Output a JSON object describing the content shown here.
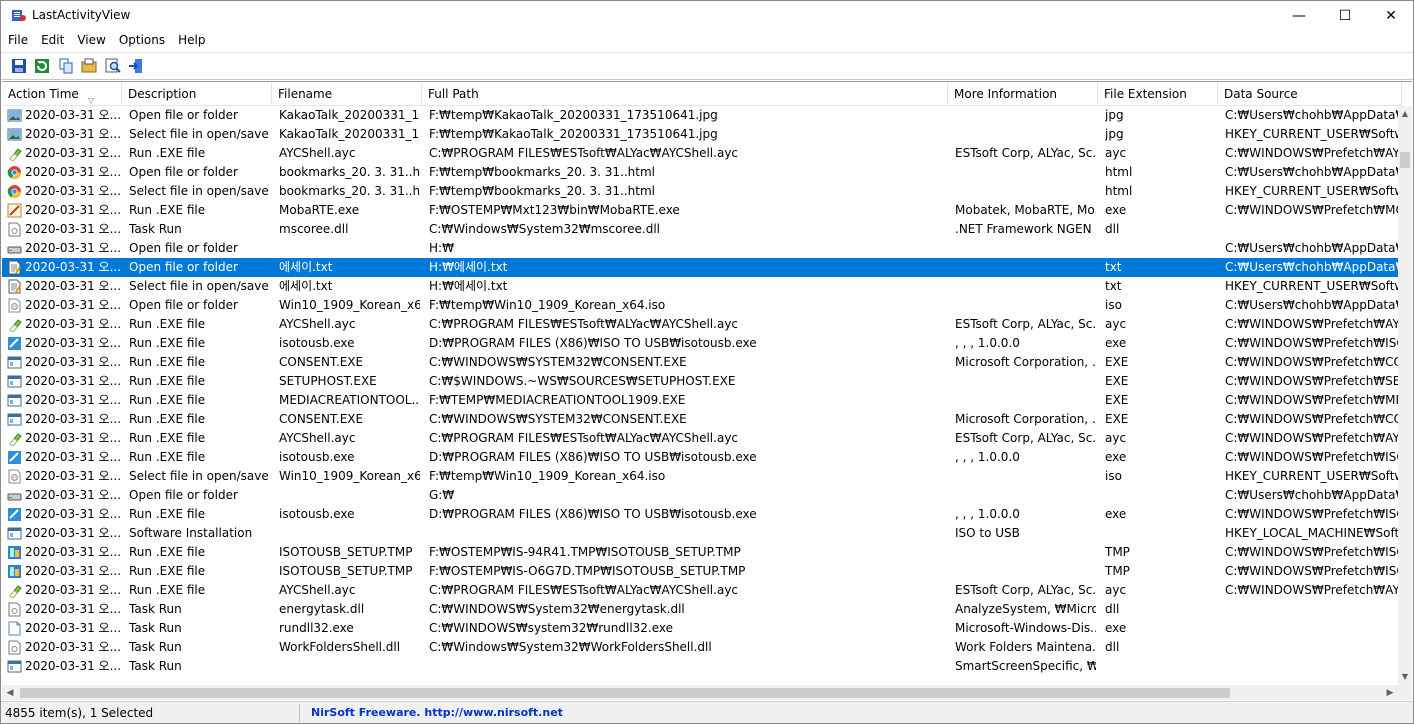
{
  "window": {
    "title": "LastActivityView",
    "minimize_glyph": "—",
    "maximize_glyph": "☐",
    "close_glyph": "✕"
  },
  "menu": [
    "File",
    "Edit",
    "View",
    "Options",
    "Help"
  ],
  "toolbar": {
    "buttons": [
      "save-icon",
      "refresh-icon",
      "copy-icon",
      "properties-icon",
      "find-icon",
      "exit-icon"
    ]
  },
  "columns": [
    "Action Time",
    "Description",
    "Filename",
    "Full Path",
    "More Information",
    "File Extension",
    "Data Source"
  ],
  "sort_indicator": "▽",
  "rows": [
    {
      "icon": "image-file-icon",
      "time": "2020-03-31 오...",
      "desc": "Open file or folder",
      "file": "KakaoTalk_20200331_1...",
      "path": "F:₩temp₩KakaoTalk_20200331_173510641.jpg",
      "info": "",
      "ext": "jpg",
      "src": "C:₩Users₩chohb₩AppData₩Roa"
    },
    {
      "icon": "image-file-icon",
      "time": "2020-03-31 오...",
      "desc": "Select file in open/save ...",
      "file": "KakaoTalk_20200331_1...",
      "path": "F:₩temp₩KakaoTalk_20200331_173510641.jpg",
      "info": "",
      "ext": "jpg",
      "src": "HKEY_CURRENT_USER₩Software"
    },
    {
      "icon": "alyac-pill-icon",
      "time": "2020-03-31 오...",
      "desc": "Run .EXE file",
      "file": "AYCShell.ayc",
      "path": "C:₩PROGRAM FILES₩ESTsoft₩ALYac₩AYCShell.ayc",
      "info": "ESTsoft Corp, ALYac, Sc...",
      "ext": "ayc",
      "src": "C:₩WINDOWS₩Prefetch₩AYCS"
    },
    {
      "icon": "chrome-icon",
      "time": "2020-03-31 오...",
      "desc": "Open file or folder",
      "file": "bookmarks_20. 3. 31..h...",
      "path": "F:₩temp₩bookmarks_20. 3. 31..html",
      "info": "",
      "ext": "html",
      "src": "C:₩Users₩chohb₩AppData₩Roa"
    },
    {
      "icon": "chrome-icon",
      "time": "2020-03-31 오...",
      "desc": "Select file in open/save ...",
      "file": "bookmarks_20. 3. 31..h...",
      "path": "F:₩temp₩bookmarks_20. 3. 31..html",
      "info": "",
      "ext": "html",
      "src": "HKEY_CURRENT_USER₩Software"
    },
    {
      "icon": "mobarte-icon",
      "time": "2020-03-31 오...",
      "desc": "Run .EXE file",
      "file": "MobaRTE.exe",
      "path": "F:₩OSTEMP₩Mxt123₩bin₩MobaRTE.exe",
      "info": "Mobatek, MobaRTE, Mo...",
      "ext": "exe",
      "src": "C:₩WINDOWS₩Prefetch₩MOBA"
    },
    {
      "icon": "dll-file-icon",
      "time": "2020-03-31 오...",
      "desc": "Task Run",
      "file": "mscoree.dll",
      "path": "C:₩Windows₩System32₩mscoree.dll",
      "info": ".NET Framework NGEN ...",
      "ext": "dll",
      "src": ""
    },
    {
      "icon": "drive-icon",
      "time": "2020-03-31 오...",
      "desc": "Open file or folder",
      "file": "",
      "path": "H:₩",
      "info": "",
      "ext": "",
      "src": "C:₩Users₩chohb₩AppData₩Roa"
    },
    {
      "icon": "text-file-icon",
      "time": "2020-03-31 오...",
      "desc": "Open file or folder",
      "file": "에세이.txt",
      "path": "H:₩에세이.txt",
      "info": "",
      "ext": "txt",
      "src": "C:₩Users₩chohb₩AppData₩Roa",
      "selected": true
    },
    {
      "icon": "text-file-icon",
      "time": "2020-03-31 오...",
      "desc": "Select file in open/save ...",
      "file": "에세이.txt",
      "path": "H:₩에세이.txt",
      "info": "",
      "ext": "txt",
      "src": "HKEY_CURRENT_USER₩Software"
    },
    {
      "icon": "iso-file-icon",
      "time": "2020-03-31 오...",
      "desc": "Open file or folder",
      "file": "Win10_1909_Korean_x6...",
      "path": "F:₩temp₩Win10_1909_Korean_x64.iso",
      "info": "",
      "ext": "iso",
      "src": "C:₩Users₩chohb₩AppData₩Roa"
    },
    {
      "icon": "alyac-pill-icon",
      "time": "2020-03-31 오...",
      "desc": "Run .EXE file",
      "file": "AYCShell.ayc",
      "path": "C:₩PROGRAM FILES₩ESTsoft₩ALYac₩AYCShell.ayc",
      "info": "ESTsoft Corp, ALYac, Sc...",
      "ext": "ayc",
      "src": "C:₩WINDOWS₩Prefetch₩AYCS"
    },
    {
      "icon": "isotousb-icon",
      "time": "2020-03-31 오...",
      "desc": "Run .EXE file",
      "file": "isotousb.exe",
      "path": "D:₩PROGRAM FILES (X86)₩ISO TO USB₩isotousb.exe",
      "info": ", , , 1.0.0.0",
      "ext": "exe",
      "src": "C:₩WINDOWS₩Prefetch₩ISOTC"
    },
    {
      "icon": "exe-window-icon",
      "time": "2020-03-31 오...",
      "desc": "Run .EXE file",
      "file": "CONSENT.EXE",
      "path": "C:₩WINDOWS₩SYSTEM32₩CONSENT.EXE",
      "info": "Microsoft Corporation, ...",
      "ext": "EXE",
      "src": "C:₩WINDOWS₩Prefetch₩CONS"
    },
    {
      "icon": "exe-window-icon",
      "time": "2020-03-31 오...",
      "desc": "Run .EXE file",
      "file": "SETUPHOST.EXE",
      "path": "C:₩$WINDOWS.~WS₩SOURCES₩SETUPHOST.EXE",
      "info": "",
      "ext": "EXE",
      "src": "C:₩WINDOWS₩Prefetch₩SETUP"
    },
    {
      "icon": "exe-window-icon",
      "time": "2020-03-31 오...",
      "desc": "Run .EXE file",
      "file": "MEDIACREATIONTOOL...",
      "path": "F:₩TEMP₩MEDIACREATIONTOOL1909.EXE",
      "info": "",
      "ext": "EXE",
      "src": "C:₩WINDOWS₩Prefetch₩MEDI"
    },
    {
      "icon": "exe-window-icon",
      "time": "2020-03-31 오...",
      "desc": "Run .EXE file",
      "file": "CONSENT.EXE",
      "path": "C:₩WINDOWS₩SYSTEM32₩CONSENT.EXE",
      "info": "Microsoft Corporation, ...",
      "ext": "EXE",
      "src": "C:₩WINDOWS₩Prefetch₩CONS"
    },
    {
      "icon": "alyac-pill-icon",
      "time": "2020-03-31 오...",
      "desc": "Run .EXE file",
      "file": "AYCShell.ayc",
      "path": "C:₩PROGRAM FILES₩ESTsoft₩ALYac₩AYCShell.ayc",
      "info": "ESTsoft Corp, ALYac, Sc...",
      "ext": "ayc",
      "src": "C:₩WINDOWS₩Prefetch₩AYCS"
    },
    {
      "icon": "isotousb-icon",
      "time": "2020-03-31 오...",
      "desc": "Run .EXE file",
      "file": "isotousb.exe",
      "path": "D:₩PROGRAM FILES (X86)₩ISO TO USB₩isotousb.exe",
      "info": ", , , 1.0.0.0",
      "ext": "exe",
      "src": "C:₩WINDOWS₩Prefetch₩ISOTC"
    },
    {
      "icon": "iso-file-icon",
      "time": "2020-03-31 오...",
      "desc": "Select file in open/save ...",
      "file": "Win10_1909_Korean_x6...",
      "path": "F:₩temp₩Win10_1909_Korean_x64.iso",
      "info": "",
      "ext": "iso",
      "src": "HKEY_CURRENT_USER₩Software"
    },
    {
      "icon": "drive-icon",
      "time": "2020-03-31 오...",
      "desc": "Open file or folder",
      "file": "",
      "path": "G:₩",
      "info": "",
      "ext": "",
      "src": "C:₩Users₩chohb₩AppData₩Roa"
    },
    {
      "icon": "isotousb-icon",
      "time": "2020-03-31 오...",
      "desc": "Run .EXE file",
      "file": "isotousb.exe",
      "path": "D:₩PROGRAM FILES (X86)₩ISO TO USB₩isotousb.exe",
      "info": ", , , 1.0.0.0",
      "ext": "exe",
      "src": "C:₩WINDOWS₩Prefetch₩ISOTC"
    },
    {
      "icon": "exe-window-icon",
      "time": "2020-03-31 오...",
      "desc": "Software Installation",
      "file": "",
      "path": "",
      "info": "ISO to USB",
      "ext": "",
      "src": "HKEY_LOCAL_MACHINE₩Softw"
    },
    {
      "icon": "setup-tmp-icon",
      "time": "2020-03-31 오...",
      "desc": "Run .EXE file",
      "file": "ISOTOUSB_SETUP.TMP",
      "path": "F:₩OSTEMP₩IS-94R41.TMP₩ISOTOUSB_SETUP.TMP",
      "info": "",
      "ext": "TMP",
      "src": "C:₩WINDOWS₩Prefetch₩ISOTC"
    },
    {
      "icon": "setup-tmp-icon",
      "time": "2020-03-31 오...",
      "desc": "Run .EXE file",
      "file": "ISOTOUSB_SETUP.TMP",
      "path": "F:₩OSTEMP₩IS-O6G7D.TMP₩ISOTOUSB_SETUP.TMP",
      "info": "",
      "ext": "TMP",
      "src": "C:₩WINDOWS₩Prefetch₩ISOTC"
    },
    {
      "icon": "alyac-pill-icon",
      "time": "2020-03-31 오...",
      "desc": "Run .EXE file",
      "file": "AYCShell.ayc",
      "path": "C:₩PROGRAM FILES₩ESTsoft₩ALYac₩AYCShell.ayc",
      "info": "ESTsoft Corp, ALYac, Sc...",
      "ext": "ayc",
      "src": "C:₩WINDOWS₩Prefetch₩AYCS"
    },
    {
      "icon": "dll-file-icon",
      "time": "2020-03-31 오...",
      "desc": "Task Run",
      "file": "energytask.dll",
      "path": "C:₩WINDOWS₩System32₩energytask.dll",
      "info": "AnalyzeSystem, ₩Micro...",
      "ext": "dll",
      "src": ""
    },
    {
      "icon": "blank-file-icon",
      "time": "2020-03-31 오...",
      "desc": "Task Run",
      "file": "rundll32.exe",
      "path": "C:₩WINDOWS₩system32₩rundll32.exe",
      "info": "Microsoft-Windows-Dis...",
      "ext": "exe",
      "src": ""
    },
    {
      "icon": "dll-file-icon",
      "time": "2020-03-31 오...",
      "desc": "Task Run",
      "file": "WorkFoldersShell.dll",
      "path": "C:₩Windows₩System32₩WorkFoldersShell.dll",
      "info": "Work Folders Maintena...",
      "ext": "dll",
      "src": ""
    },
    {
      "icon": "exe-window-icon",
      "time": "2020-03-31 오...",
      "desc": "Task Run",
      "file": "",
      "path": "",
      "info": "SmartScreenSpecific, ₩...",
      "ext": "",
      "src": ""
    }
  ],
  "scroll": {
    "up": "▲",
    "down": "▼",
    "left": "◀",
    "right": "▶"
  },
  "status": {
    "count": "4855 item(s), 1 Selected",
    "link": "NirSoft Freeware.  http://www.nirsoft.net"
  }
}
